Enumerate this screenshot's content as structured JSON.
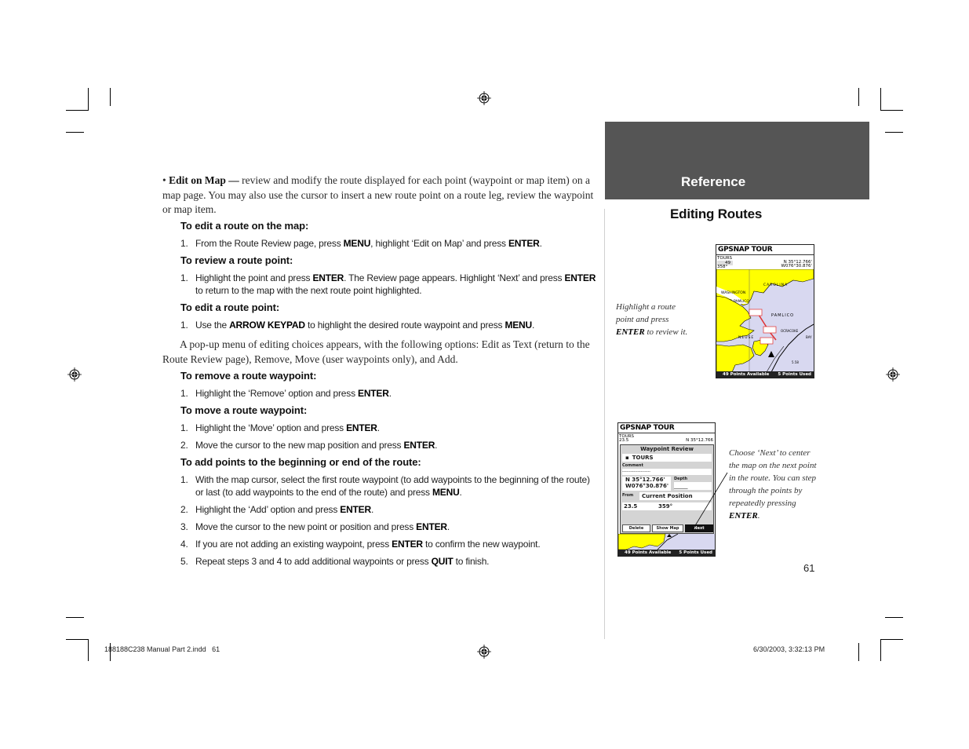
{
  "page": {
    "number": "61",
    "header_band": "Reference",
    "section_title": "Editing Routes"
  },
  "intro": {
    "bullet": "•",
    "lead": "Edit on Map —",
    "text": " review and modify the route displayed for each point (waypoint or map item) on a map page. You may also use the cursor to insert a new route point on a route leg, review the waypoint or map item."
  },
  "sections": [
    {
      "heading": "To edit a route on the map:",
      "steps": [
        {
          "n": "1.",
          "parts": [
            "From the Route Review page, press ",
            "MENU",
            ", highlight ‘Edit on Map’ and press ",
            "ENTER",
            "."
          ]
        }
      ]
    },
    {
      "heading": "To review a route point:",
      "steps": [
        {
          "n": "1.",
          "parts": [
            "Highlight the point and press ",
            "ENTER",
            ". The Review page appears. Highlight ‘Next’ and press ",
            "ENTER",
            " to return to the map with the next route point highlighted."
          ]
        }
      ]
    },
    {
      "heading": "To edit a route point:",
      "steps": [
        {
          "n": "1.",
          "parts": [
            "Use the ",
            "ARROW KEYPAD",
            " to highlight the desired route waypoint and press ",
            "MENU",
            "."
          ]
        }
      ]
    },
    {
      "heading": "To remove a route waypoint:",
      "steps": [
        {
          "n": "1.",
          "parts": [
            "Highlight the ‘Remove’ option and press ",
            "ENTER",
            "."
          ]
        }
      ]
    },
    {
      "heading": "To move a route waypoint:",
      "steps": [
        {
          "n": "1.",
          "parts": [
            "Highlight the ‘Move’ option and press ",
            "ENTER",
            "."
          ]
        },
        {
          "n": "2.",
          "parts": [
            "Move the cursor to the new map position and press ",
            "ENTER",
            "."
          ]
        }
      ]
    },
    {
      "heading": "To add points to the beginning or end of the route:",
      "steps": [
        {
          "n": "1.",
          "parts": [
            "With the map cursor, select the first route waypoint (to add waypoints to the beginning of the route) or last (to add waypoints to the end of the route) and press ",
            "MENU",
            "."
          ]
        },
        {
          "n": "2.",
          "parts": [
            "Highlight the ‘Add’ option and press ",
            "ENTER",
            "."
          ]
        },
        {
          "n": "3.",
          "parts": [
            "Move the cursor to the new point or position and press ",
            "ENTER",
            "."
          ]
        },
        {
          "n": "4.",
          "parts": [
            "If you are not adding an existing waypoint, press ",
            "ENTER",
            " to confirm the new waypoint."
          ]
        },
        {
          "n": "5.",
          "parts": [
            "Repeat steps 3 and 4 to add additional waypoints or press ",
            "QUIT",
            " to finish."
          ]
        }
      ]
    }
  ],
  "popup_paragraph": "A pop-up menu of editing choices appears, with the following options: Edit as Text (return to the Route Review page), Remove, Move (user waypoints only), and Add.",
  "captions": {
    "map": {
      "before": "Highlight a route point and press ",
      "bold": "ENTER",
      "after": " to review it."
    },
    "review": {
      "before": "Choose ‘Next’ to center the map on the next point in the route. You can step through the points by repeatedly pressing ",
      "bold": "ENTER",
      "after": "."
    }
  },
  "screen_map": {
    "title": "GPSNAP TOUR",
    "route_name": "TOURS",
    "dist": "49",
    "bearing": "358°",
    "lat": "N 35°12.766'",
    "lon": "W076°30.876'",
    "labels": [
      "WASHINGTON",
      "CAROLINA",
      "PAMLICO",
      "PAMLICO",
      "OCRACOKE",
      "NEUSE",
      "BAY"
    ],
    "scale": "5.58",
    "points_available": "49 Points Available",
    "points_used": "5 Points Used",
    "colors": {
      "land": "#ffff00",
      "water": "#d8d8f0",
      "route": "#e03030"
    }
  },
  "screen_review": {
    "title": "GPSNAP TOUR",
    "route_name": "TOURS",
    "dist": "23.5",
    "lat_short": "N 35°12.766",
    "dialog_title": "Waypoint Review",
    "waypoint": "TOURS",
    "comment_label": "Comment",
    "comment_value": "--------------------",
    "lat": "N 35°12.766'",
    "lon": "W076°30.876'",
    "depth_label": "Depth",
    "depth_value": "_____",
    "from_label": "From",
    "from_value": "Current Position",
    "distance": "23.5",
    "bearing": "359°",
    "buttons": [
      "Delete",
      "Show Map",
      "Next"
    ],
    "points_available": "49 Points Available",
    "points_used": "5 Points Used"
  },
  "footer": {
    "file": "188188C238 Manual Part 2.indd   61",
    "timestamp": "6/30/2003, 3:32:13 PM"
  }
}
